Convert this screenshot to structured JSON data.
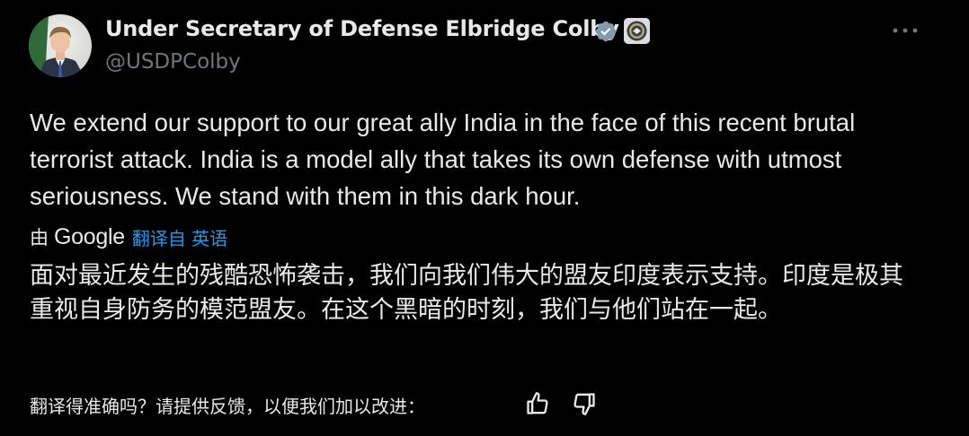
{
  "author": {
    "display_name": "Under Secretary of Defense Elbridge Colby",
    "handle": "@USDPColby",
    "verified_badge": "gray-verified-badge-icon",
    "affiliation_badge": "dod-seal-badge",
    "avatar": "profile-photo"
  },
  "tweet": {
    "text": "We extend our support to our great ally India in the face of this recent brutal terrorist attack. India is a model ally that takes its own defense with utmost seriousness. We stand with them in this dark hour."
  },
  "translation": {
    "by_prefix": "由",
    "provider": "Google",
    "link_label": "翻译自 英语",
    "text": "面对最近发生的残酷恐怖袭击，我们向我们伟大的盟友印度表示支持。印度是极其重视自身防务的模范盟友。在这个黑暗的时刻，我们与他们站在一起。",
    "feedback_prompt": "翻译得准确吗？请提供反馈，以便我们加以改进："
  },
  "colors": {
    "background": "#000000",
    "text_primary": "#e7e9ea",
    "text_secondary": "#71767b",
    "link": "#1d9bf0"
  },
  "icons": {
    "more": "more-horizontal-icon",
    "thumbs_up": "thumbs-up-icon",
    "thumbs_down": "thumbs-down-icon"
  }
}
